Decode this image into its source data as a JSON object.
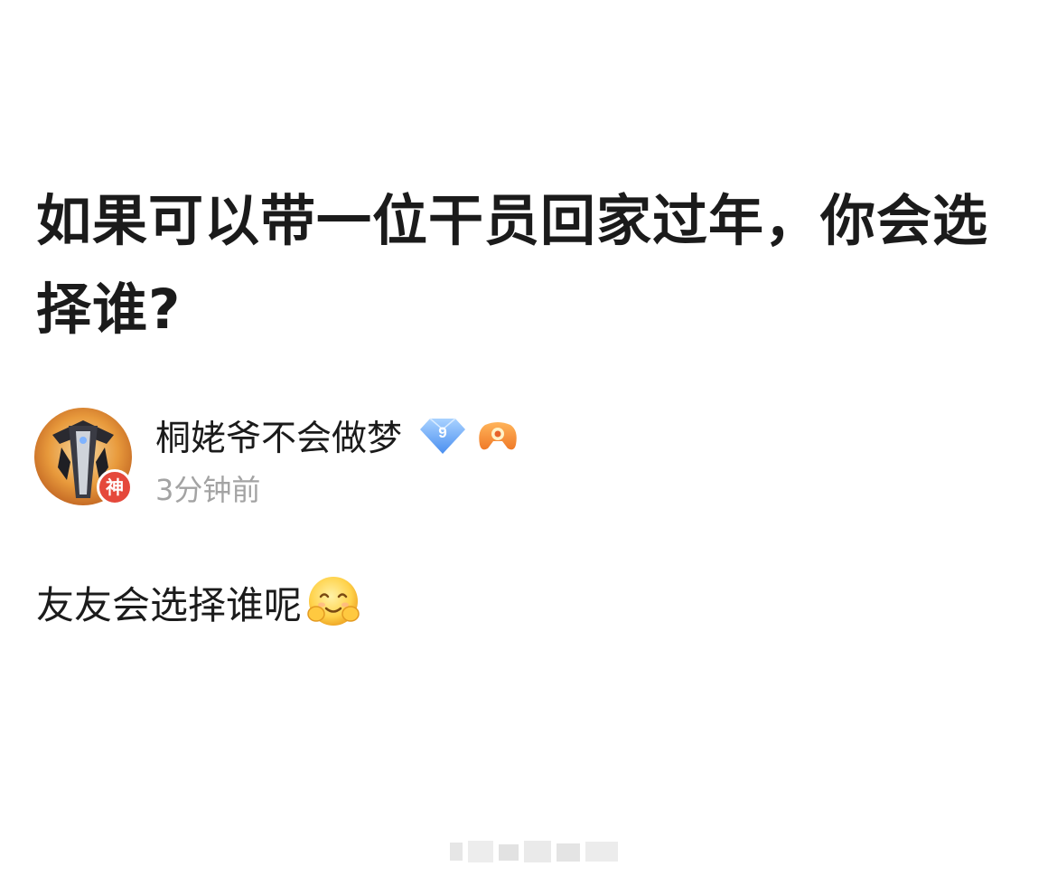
{
  "post": {
    "title": "如果可以带一位干员回家过年，你会选择谁?",
    "author": {
      "name": "桐姥爷不会做梦",
      "avatar_badge": "神",
      "level": "9",
      "timestamp": "3分钟前",
      "icons": [
        "level-diamond-icon",
        "game-controller-icon"
      ]
    },
    "body_text": "友友会选择谁呢",
    "emoji": "hugging-face-emoji"
  },
  "colors": {
    "text": "#1b1b1b",
    "muted": "#a3a3a3",
    "badge_red": "#e5483b",
    "level_blue": "#5a9ef5"
  }
}
